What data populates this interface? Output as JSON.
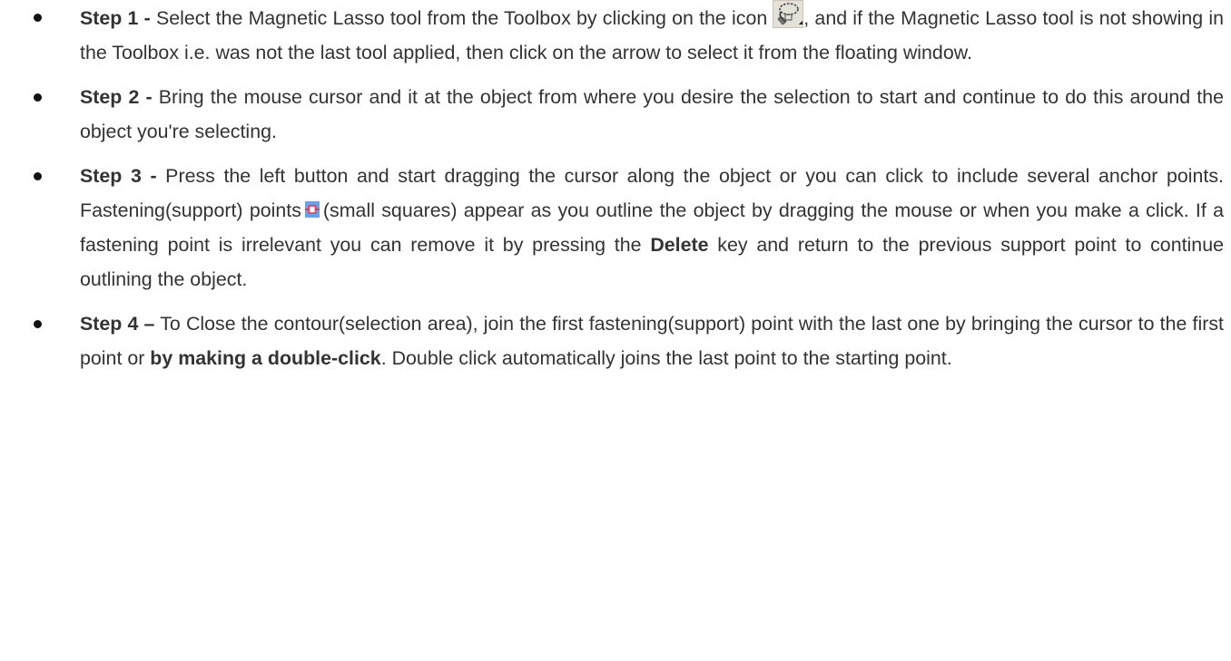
{
  "steps": [
    {
      "label": "Step 1 -",
      "text_a": " Select the Magnetic Lasso tool from the Toolbox by clicking on the icon",
      "icon": "magnetic-lasso-tool-icon",
      "text_b": ", and if the Magnetic Lasso tool is not showing in the Toolbox i.e. was not the last tool applied, then click on the arrow to select it from the floating window."
    },
    {
      "label": "Step 2 -",
      "text_a": " Bring the mouse cursor and it at the object from where you desire the selection to start and continue to do this around the object you're selecting."
    },
    {
      "label": "Step 3 -",
      "text_a": " Press the left button and start dragging the cursor along the object or you can click to include several anchor points. Fastening(support) points",
      "icon": "fastening-point-icon",
      "text_b": "(small squares) appear as you outline the object by dragging the mouse or when you make a click. If a fastening point is irrelevant you can remove it by pressing the ",
      "keyword": "Delete",
      "text_c": " key and return to the previous support point to continue outlining the object."
    },
    {
      "label": "Step 4 –",
      "text_a": " To Close the contour(selection area), join the first fastening(support) point with the last one by bringing the cursor to the first point or ",
      "keyword": "by making a double-click",
      "text_b": ". Double click automatically joins the last point to the starting point."
    }
  ],
  "colors": {
    "text": "#333333",
    "background": "#ffffff",
    "anchor_blue": "#6aa0e8",
    "anchor_red": "#e23a5a"
  }
}
